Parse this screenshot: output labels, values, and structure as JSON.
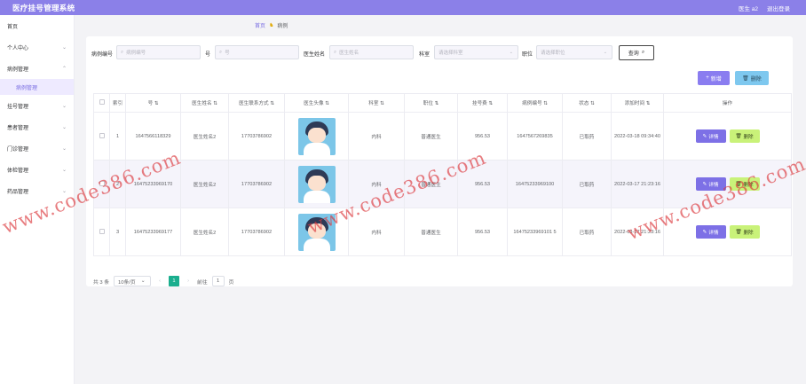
{
  "topbar": {
    "title": "医疗挂号管理系统",
    "user": "医生 a2",
    "logout": "退出登录"
  },
  "sidebar": {
    "items": [
      {
        "label": "首页",
        "chevron": ""
      },
      {
        "label": "个人中心",
        "chevron": "⌄"
      },
      {
        "label": "病例管理",
        "chevron": "⌃"
      },
      {
        "label": "病例管理",
        "chevron": ""
      },
      {
        "label": "挂号管理",
        "chevron": "⌄"
      },
      {
        "label": "患者管理",
        "chevron": "⌄"
      },
      {
        "label": "门诊管理",
        "chevron": "⌄"
      },
      {
        "label": "体检管理",
        "chevron": "⌄"
      },
      {
        "label": "药品管理",
        "chevron": "⌄"
      }
    ]
  },
  "breadcrumb": {
    "home": "首页",
    "current": "病例"
  },
  "search": {
    "fields": [
      {
        "label": "病例编号",
        "placeholder": "病例编号"
      },
      {
        "label": "号",
        "placeholder": "号"
      },
      {
        "label": "医生姓名",
        "placeholder": "医生姓名"
      },
      {
        "label": "科室",
        "placeholder": "请选择科室"
      },
      {
        "label": "职位",
        "placeholder": "请选择职位"
      }
    ],
    "query_button": "查询"
  },
  "actions": {
    "add": "新增",
    "delete": "删除"
  },
  "table": {
    "headers": [
      "索引",
      "号",
      "医生姓名",
      "医生联系方式",
      "医生头像",
      "科室",
      "职位",
      "挂号费",
      "病例编号",
      "状态",
      "添加时间",
      "操作"
    ],
    "rows": [
      {
        "index": "1",
        "no": "1647566118329",
        "doctor": "医生姓名2",
        "phone": "17703786902",
        "dept": "内科",
        "position": "普通医生",
        "fee": "956.53",
        "case_no": "1647567269835",
        "status": "已取药",
        "time": "2022-03-18 09:34:40"
      },
      {
        "index": "2",
        "no": "16475233969170",
        "doctor": "医生姓名2",
        "phone": "17703786902",
        "dept": "内科",
        "position": "普通医生",
        "fee": "956.53",
        "case_no": "16475233969100",
        "status": "已取药",
        "time": "2022-03-17 21:23:16"
      },
      {
        "index": "3",
        "no": "16475233969177",
        "doctor": "医生姓名2",
        "phone": "17703786902",
        "dept": "内科",
        "position": "普通医生",
        "fee": "956.53",
        "case_no": "16475233969101 5",
        "status": "已取药",
        "time": "2022-03-17 21:23:16"
      }
    ],
    "row_buttons": {
      "detail": "详情",
      "delete": "删除"
    }
  },
  "pagination": {
    "total": "共 3 条",
    "page_size": "10条/页",
    "current": "1",
    "goto": "前往",
    "goto_value": "1",
    "page_unit": "页"
  },
  "watermark": "www.code386.com"
}
